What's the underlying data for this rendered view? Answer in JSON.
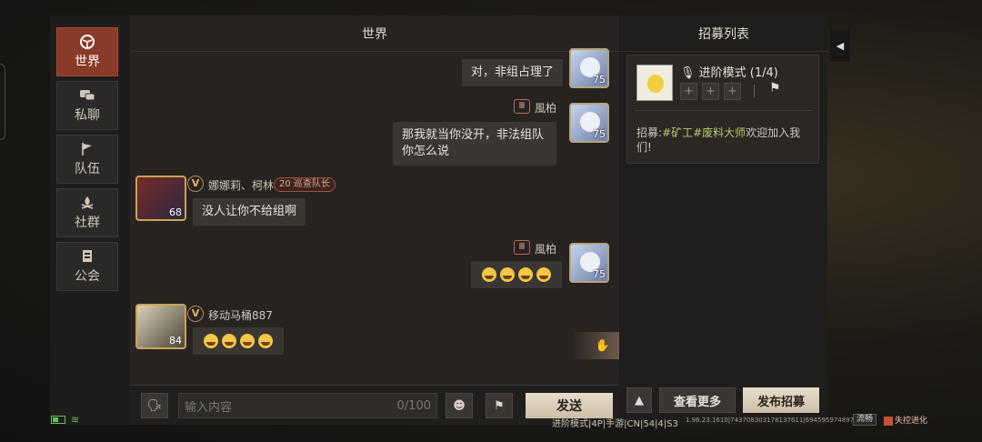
{
  "nav": {
    "items": [
      {
        "label": "世界",
        "icon": "globe-icon",
        "active": true
      },
      {
        "label": "私聊",
        "icon": "chat-bubbles-icon",
        "active": false
      },
      {
        "label": "队伍",
        "icon": "flag-icon",
        "active": false
      },
      {
        "label": "社群",
        "icon": "campfire-icon",
        "active": false
      },
      {
        "label": "公会",
        "icon": "guild-banner-icon",
        "active": false
      }
    ]
  },
  "chat": {
    "title": "世界",
    "messages": [
      {
        "sender": "風柏",
        "level": "75",
        "text": "对，非组占理了"
      },
      {
        "sender": "風柏",
        "level": "75",
        "text": "那我就当你没开，非法组队 你怎么说"
      },
      {
        "sender": "娜娜莉、柯林",
        "level": "68",
        "badge": "V",
        "tag_level": "20",
        "tag": "巡查队长",
        "text": "没人让你不给组啊"
      },
      {
        "sender": "風柏",
        "level": "75",
        "text": "😭😭😭😭"
      },
      {
        "sender": "移动马桶887",
        "level": "84",
        "badge": "V",
        "text": "😭😭😭😭"
      }
    ],
    "input_placeholder": "输入内容",
    "char_count": "0/100",
    "send_label": "发送"
  },
  "recruit": {
    "title": "招募列表",
    "card": {
      "mode": "进阶模式 (1/4)",
      "slots": [
        "+",
        "+",
        "+"
      ],
      "desc_prefix": "招募:",
      "tags": "#矿工#废料大师",
      "desc_suffix": "欢迎加入我们!"
    },
    "more_label": "查看更多",
    "post_label": "发布招募"
  },
  "status": {
    "mode_info": "进阶模式|4P|手游|CN|54|4|S3",
    "build_info": "1.96.23.1610|743708303178137611|6945959748973363​4",
    "flow_label": "流畅",
    "logo_text": "失控进化"
  },
  "colors": {
    "accent": "#8a3a28",
    "tag_green": "#b9c96a",
    "send_button": "#e0d4c0"
  }
}
